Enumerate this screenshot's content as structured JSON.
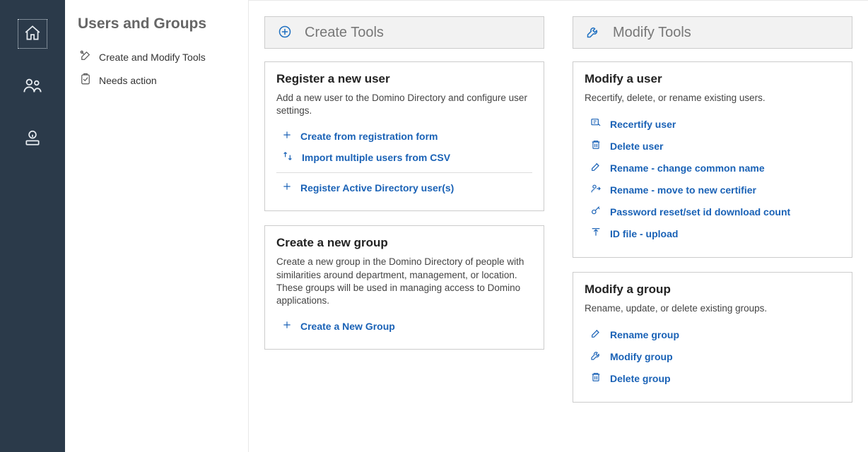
{
  "side": {
    "heading": "Users and Groups",
    "items": [
      {
        "label": "Create and Modify Tools"
      },
      {
        "label": "Needs action"
      }
    ]
  },
  "create": {
    "header": "Create Tools",
    "card1": {
      "title": "Register a new user",
      "desc": "Add a new user to the Domino Directory and configure user settings.",
      "a1": "Create from registration form",
      "a2": "Import multiple users from CSV",
      "a3": "Register Active Directory user(s)"
    },
    "card2": {
      "title": "Create a new group",
      "desc": "Create a new group in the Domino Directory of people with similarities around department, management, or location.  These groups will be used in managing access to Domino applications.",
      "a1": "Create a New Group"
    }
  },
  "modify": {
    "header": "Modify Tools",
    "card1": {
      "title": "Modify a user",
      "desc": "Recertify, delete, or rename existing users.",
      "a1": "Recertify user",
      "a2": "Delete user",
      "a3": "Rename - change common name",
      "a4": "Rename - move to new certifier",
      "a5": "Password reset/set id download count",
      "a6": "ID file - upload"
    },
    "card2": {
      "title": "Modify a group",
      "desc": "Rename, update, or delete existing groups.",
      "a1": "Rename group",
      "a2": "Modify group",
      "a3": "Delete group"
    }
  }
}
